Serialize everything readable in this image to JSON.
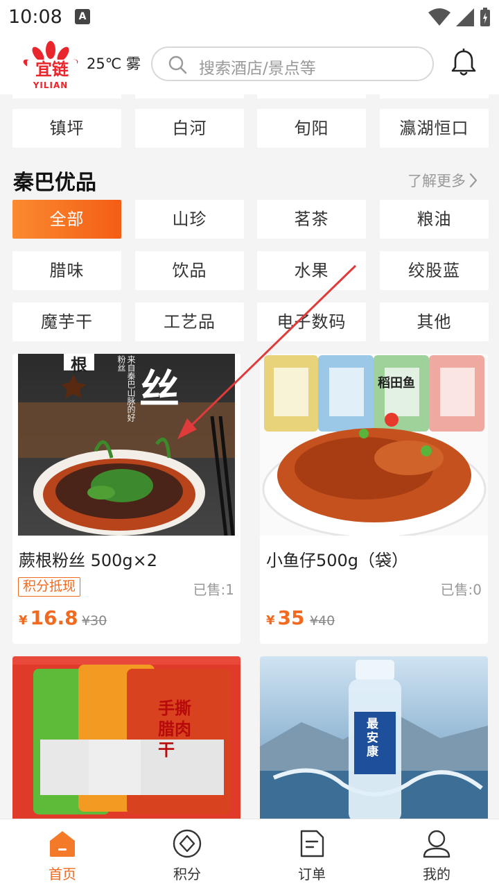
{
  "status_bar": {
    "time": "10:08",
    "notif": "A"
  },
  "header": {
    "logo_text": "宜链",
    "logo_sub": "YILIAN",
    "weather": "25℃ 雾",
    "search_placeholder": "搜索酒店/景点等"
  },
  "regions": [
    "镇坪",
    "白河",
    "旬阳",
    "瀛湖恒口"
  ],
  "section": {
    "title": "秦巴优品",
    "more": "了解更多"
  },
  "categories": [
    [
      "全部",
      "山珍",
      "茗茶",
      "粮油"
    ],
    [
      "腊味",
      "饮品",
      "水果",
      "绞股蓝"
    ],
    [
      "魔芋干",
      "工艺品",
      "电子数码",
      "其他"
    ]
  ],
  "products": [
    {
      "name": "蕨根粉丝 500g×2",
      "badge": "积分抵现",
      "sold": "已售:1",
      "currency": "¥",
      "price": "16.8",
      "old_price": "¥30",
      "image_text": {
        "big": "丝",
        "side": "来自秦巴山脉的好粉丝",
        "corner": "根"
      }
    },
    {
      "name": "小鱼仔500g（袋）",
      "badge": "",
      "sold": "已售:0",
      "currency": "¥",
      "price": "35",
      "old_price": "¥40",
      "image_text": {
        "brand": "稻田鱼"
      }
    },
    {
      "name": "",
      "image_text": {
        "brand": "手撕腊肉干"
      }
    },
    {
      "name": "",
      "image_text": {
        "brand": "最安康"
      }
    }
  ],
  "bottom_nav": [
    {
      "label": "首页",
      "icon": "home-icon",
      "active": true
    },
    {
      "label": "积分",
      "icon": "points-icon",
      "active": false
    },
    {
      "label": "订单",
      "icon": "order-icon",
      "active": false
    },
    {
      "label": "我的",
      "icon": "profile-icon",
      "active": false
    }
  ],
  "colors": {
    "accent": "#f16a1f",
    "accent_light": "#fa8a30",
    "logo_red": "#e8262c",
    "annotation_arrow": "#e03a3a"
  }
}
